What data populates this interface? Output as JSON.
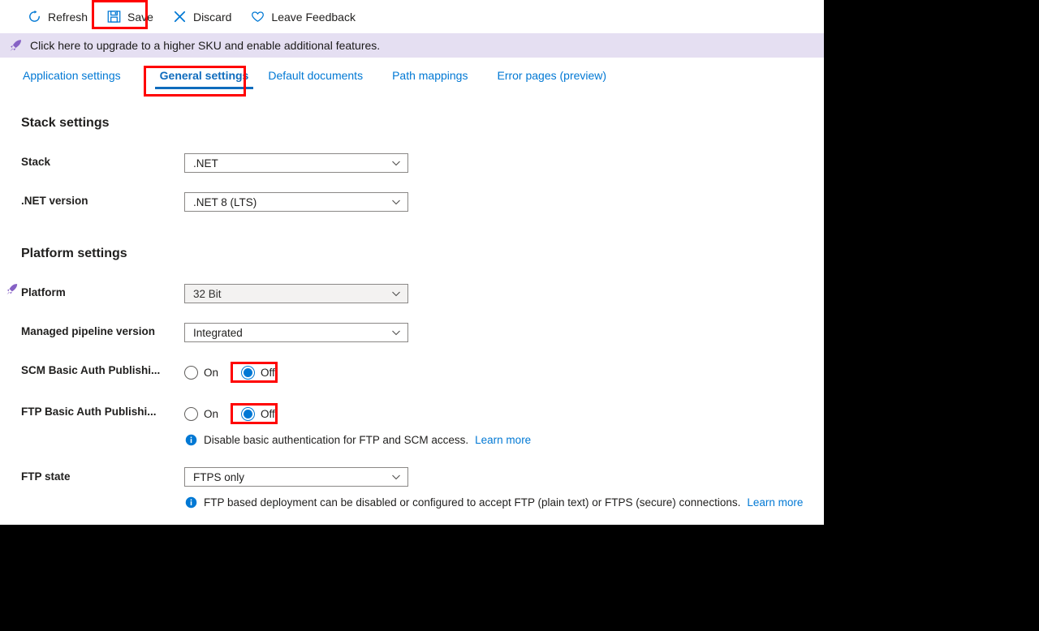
{
  "toolbar": {
    "refresh_label": "Refresh",
    "save_label": "Save",
    "discard_label": "Discard",
    "feedback_label": "Leave Feedback"
  },
  "banner": {
    "text": "Click here to upgrade to a higher SKU and enable additional features.",
    "background": "#e5dff2",
    "icon": "rocket-icon"
  },
  "tabs": [
    {
      "label": "Application settings",
      "active": false
    },
    {
      "label": "General settings",
      "active": true
    },
    {
      "label": "Default documents",
      "active": false
    },
    {
      "label": "Path mappings",
      "active": false
    },
    {
      "label": "Error pages (preview)",
      "active": false
    }
  ],
  "sections": {
    "stack": {
      "title": "Stack settings",
      "stack": {
        "label": "Stack",
        "value": ".NET"
      },
      "dotnet_version": {
        "label": ".NET version",
        "value": ".NET 8 (LTS)"
      }
    },
    "platform": {
      "title": "Platform settings",
      "platform": {
        "label": "Platform",
        "value": "32 Bit",
        "disabled": true,
        "icon": "rocket-icon"
      },
      "pipeline": {
        "label": "Managed pipeline version",
        "value": "Integrated"
      },
      "scm_basic_auth": {
        "label": "SCM Basic Auth Publishi...",
        "on_label": "On",
        "off_label": "Off",
        "selected": "Off"
      },
      "ftp_basic_auth": {
        "label": "FTP Basic Auth Publishi...",
        "on_label": "On",
        "off_label": "Off",
        "selected": "Off"
      },
      "basic_auth_info": {
        "text": "Disable basic authentication for FTP and SCM access.",
        "link": "Learn more"
      },
      "ftp_state": {
        "label": "FTP state",
        "value": "FTPS only"
      },
      "ftp_state_info": {
        "text": "FTP based deployment can be disabled or configured to accept FTP (plain text) or FTPS (secure) connections.",
        "link": "Learn more"
      }
    }
  },
  "colors": {
    "accent": "#0078d4",
    "highlight": "#ff0000",
    "banner_bg": "#e5dff2",
    "rocket": "#8661c5"
  }
}
